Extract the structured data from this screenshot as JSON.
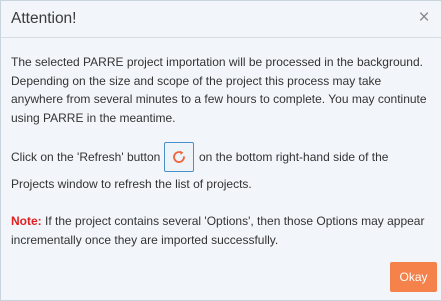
{
  "dialog": {
    "title": "Attention!",
    "close_glyph": "×",
    "paragraph1": "The selected PARRE project importation will be processed in the background. Depending on the size and scope of the project this process may take anywhere from several minutes to a few hours to complete. You may continute using PARRE in the meantime.",
    "refresh_before": "Click on the 'Refresh' button",
    "refresh_after": "on the bottom right-hand side of the",
    "refresh_line2": "Projects window to refresh the list of projects.",
    "refresh_icon": "refresh-icon",
    "note_label": "Note:",
    "note_text": "If the project contains several 'Options', then those Options may appear incrementally once they are imported successfully.",
    "okay_label": "Okay"
  },
  "colors": {
    "accent": "#f5824a",
    "note": "#e02020",
    "refresh_border": "#4a90c9",
    "refresh_icon": "#f0643c"
  }
}
